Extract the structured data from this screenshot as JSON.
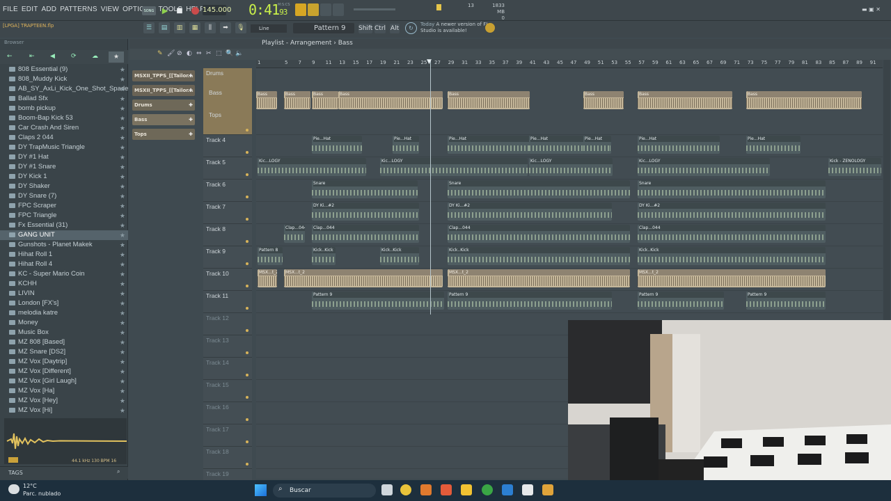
{
  "menu": [
    "FILE",
    "EDIT",
    "ADD",
    "PATTERNS",
    "VIEW",
    "OPTIONS",
    "TOOLS",
    "HELP"
  ],
  "transport": {
    "mode": "SONG",
    "tempo": "145.000",
    "time_main": "0:41",
    "time_sub": "93",
    "time_unit": "M:S:CS"
  },
  "monitor": {
    "cpu": "13",
    "memory": "1833 MB",
    "polyphony": "0"
  },
  "project": {
    "name": "[LPGA] TRAPTEEN.flp"
  },
  "toolbar2": {
    "snap": "Line",
    "pattern": "Pattern 9",
    "keys": [
      "Shift",
      "Ctrl",
      "Alt"
    ],
    "hint_prefix": "Today",
    "hint_text": "A newer version of FL Studio is available!"
  },
  "browser": {
    "title": "Browser",
    "items": [
      "808 Essential (9)",
      "808_Muddy Kick",
      "AB_SY_AxLi_Kick_One_Shot_Spade",
      "Ballad Sfx",
      "bomb pickup",
      "Boom-Bap Kick 53",
      "Car Crash And Siren",
      "Claps 2 044",
      "DY TrapMusic Triangle",
      "DY #1 Hat",
      "DY #1 Snare",
      "DY Kick 1",
      "DY Shaker",
      "DY Snare (7)",
      "FPC Scraper",
      "FPC Triangle",
      "Fx Essential (31)",
      "GANG UNIT",
      "Gunshots - Planet Makek",
      "Hihat Roll 1",
      "Hihat Roll 4",
      "KC - Super Mario Coin",
      "KCHH",
      "LIVIN",
      "London [FX's]",
      "melodia katre",
      "Money",
      "Music Box",
      "MZ 808 [Based]",
      "MZ Snare [DS2]",
      "MZ Vox [Daytrip]",
      "MZ Vox [Different]",
      "MZ Vox [Girl Laugh]",
      "MZ Vox [Ha]",
      "MZ Vox [Hey]",
      "MZ Vox [Hi]"
    ],
    "selected_index": 17,
    "sample_info": "44.1 kHz 130 BPM 16",
    "tags_label": "TAGS"
  },
  "channels": [
    "MSXII_TPPS_[[Tailor...",
    "MSXII_TPPS_[[Tailor...",
    "Drums",
    "Bass",
    "Tops"
  ],
  "playlist": {
    "title": "Playlist - Arrangement",
    "crumb": "Bass",
    "ruler": [
      "1",
      "5",
      "7",
      "9",
      "11",
      "13",
      "15",
      "17",
      "19",
      "21",
      "23",
      "25",
      "27",
      "29",
      "31",
      "33",
      "35",
      "37",
      "39",
      "41",
      "43",
      "45",
      "47",
      "49",
      "51",
      "53",
      "55",
      "57",
      "59",
      "61",
      "63",
      "65",
      "67",
      "69",
      "71",
      "73",
      "75",
      "77",
      "79",
      "81",
      "83",
      "85",
      "87",
      "89",
      "91"
    ],
    "tracks": [
      {
        "name": "Drums",
        "sub": [
          "Bass",
          "Tops"
        ]
      },
      {
        "name": "Track 4"
      },
      {
        "name": "Track 5"
      },
      {
        "name": "Track 6"
      },
      {
        "name": "Track 7"
      },
      {
        "name": "Track 8"
      },
      {
        "name": "Track 9"
      },
      {
        "name": "Track 10"
      },
      {
        "name": "Track 11"
      },
      {
        "name": "Track 12"
      },
      {
        "name": "Track 13"
      },
      {
        "name": "Track 14"
      },
      {
        "name": "Track 15"
      },
      {
        "name": "Track 16"
      },
      {
        "name": "Track 17"
      },
      {
        "name": "Track 18"
      },
      {
        "name": "Track 19"
      }
    ],
    "clip_labels": {
      "lane0": "Bass",
      "lane1": "Pie...Hat",
      "lane2": "Kic...LOGY",
      "lane2_end": "Kick - ZENOLOGY",
      "lane3": "Snare",
      "lane4": "DY Ki...#2",
      "lane5": "Clap...044",
      "lane6": "Kick..Kick",
      "lane6_start": "Pattern 8",
      "lane7": "MSX...t_2",
      "lane8": "Pattern 9"
    }
  },
  "taskbar": {
    "temp": "12°C",
    "weather": "Parc. nublado",
    "search": "Buscar"
  },
  "colors": {
    "accent": "#c9f04a",
    "clip_audio": "#c5b79a",
    "clip_pattern": "#4f5d61",
    "bg": "#424c52"
  }
}
